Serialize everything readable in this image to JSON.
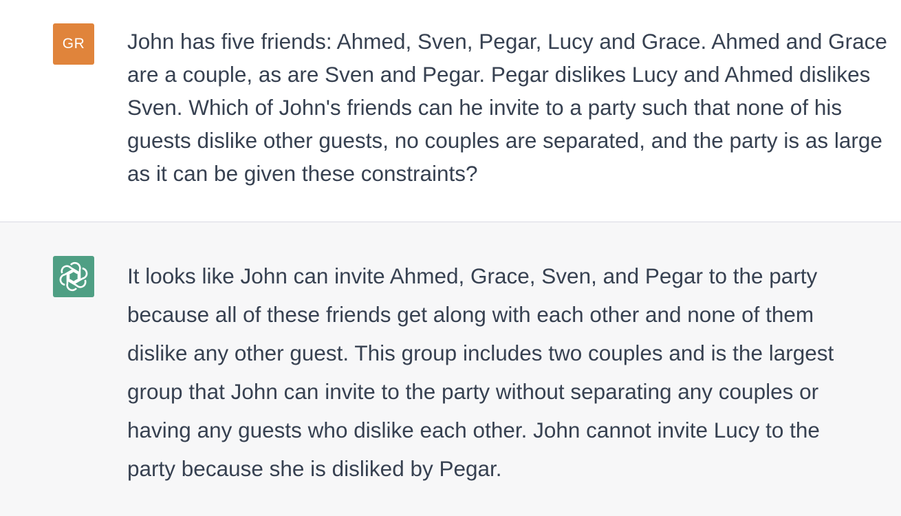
{
  "conversation": {
    "user_message": {
      "avatar_initials": "GR",
      "avatar_color": "#e0843b",
      "text": "John has five friends: Ahmed, Sven, Pegar, Lucy and Grace. Ahmed and Grace are a couple, as are Sven and Pegar. Pegar dislikes Lucy and Ahmed dislikes Sven. Which of John's friends can he invite to a party such that none of his guests dislike other guests, no couples are separated, and the party is as large as it can be given these constraints?"
    },
    "assistant_message": {
      "avatar_icon": "openai-logo-icon",
      "avatar_color": "#4f9f84",
      "text": "It looks like John can invite Ahmed, Grace, Sven, and Pegar to the party because all of these friends get along with each other and none of them dislike any other guest. This group includes two couples and is the largest group that John can invite to the party without separating any couples or having any guests who dislike each other. John cannot invite Lucy to the party because she is disliked by Pegar."
    }
  }
}
